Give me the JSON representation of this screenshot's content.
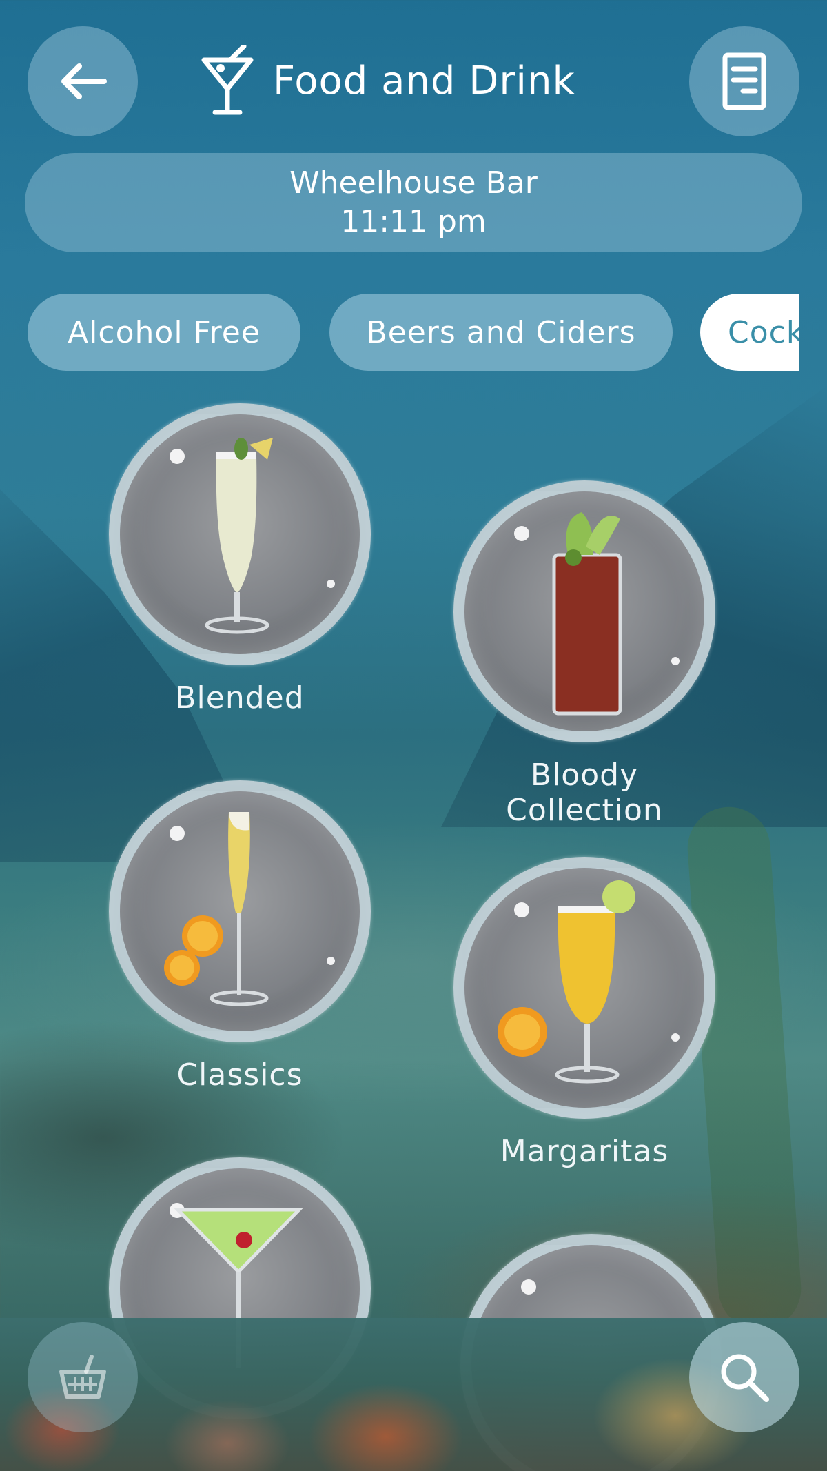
{
  "header": {
    "title": "Food and Drink"
  },
  "venue": {
    "name": "Wheelhouse Bar",
    "time": "11:11 pm"
  },
  "tabs": [
    {
      "label": "Alcohol Free"
    },
    {
      "label": "Beers and Ciders"
    },
    {
      "label": "Cocktails",
      "active": true
    }
  ],
  "categories": [
    {
      "label": "Blended",
      "drink": "blended-drink-image"
    },
    {
      "label": "Bloody Collection",
      "drink": "bloody-mary-image"
    },
    {
      "label": "Classics",
      "drink": "classic-mimosa-image"
    },
    {
      "label": "Margaritas",
      "drink": "margarita-image"
    },
    {
      "label": "",
      "drink": "martini-image"
    },
    {
      "label": "",
      "drink": "cocktail-image"
    }
  ],
  "colors": {
    "accent": "#3a8fa8",
    "pill_bg": "rgba(160,200,220,0.42)"
  }
}
